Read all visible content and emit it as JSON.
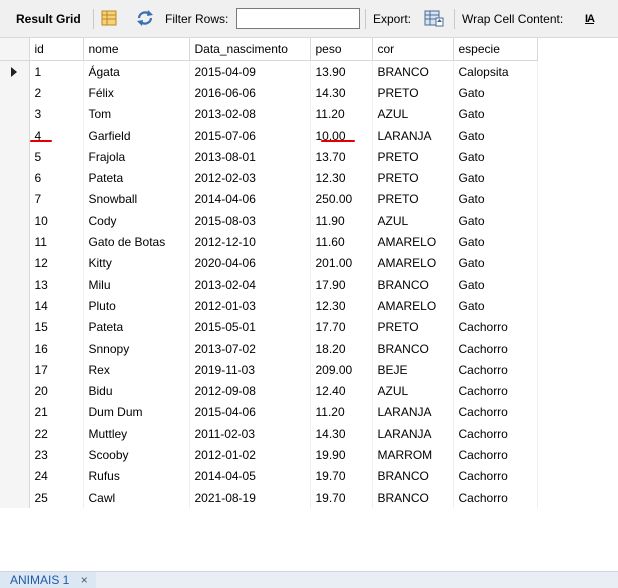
{
  "toolbar": {
    "result_grid_label": "Result Grid",
    "filter_rows_label": "Filter Rows:",
    "filter_rows_value": "",
    "export_label": "Export:",
    "wrap_cell_label": "Wrap Cell Content:",
    "wrap_icon_glyph": "IA"
  },
  "grid": {
    "columns": [
      "id",
      "nome",
      "Data_nascimento",
      "peso",
      "cor",
      "especie"
    ],
    "rows": [
      [
        "1",
        "Ágata",
        "2015-04-09",
        "13.90",
        "BRANCO",
        "Calopsita"
      ],
      [
        "2",
        "Félix",
        "2016-06-06",
        "14.30",
        "PRETO",
        "Gato"
      ],
      [
        "3",
        "Tom",
        "2013-02-08",
        "11.20",
        "AZUL",
        "Gato"
      ],
      [
        "4",
        "Garfield",
        "2015-07-06",
        "10.00",
        "LARANJA",
        "Gato"
      ],
      [
        "5",
        "Frajola",
        "2013-08-01",
        "13.70",
        "PRETO",
        "Gato"
      ],
      [
        "6",
        "Pateta",
        "2012-02-03",
        "12.30",
        "PRETO",
        "Gato"
      ],
      [
        "7",
        "Snowball",
        "2014-04-06",
        "250.00",
        "PRETO",
        "Gato"
      ],
      [
        "10",
        "Cody",
        "2015-08-03",
        "11.90",
        "AZUL",
        "Gato"
      ],
      [
        "11",
        "Gato de Botas",
        "2012-12-10",
        "11.60",
        "AMARELO",
        "Gato"
      ],
      [
        "12",
        "Kitty",
        "2020-04-06",
        "201.00",
        "AMARELO",
        "Gato"
      ],
      [
        "13",
        "Milu",
        "2013-02-04",
        "17.90",
        "BRANCO",
        "Gato"
      ],
      [
        "14",
        "Pluto",
        "2012-01-03",
        "12.30",
        "AMARELO",
        "Gato"
      ],
      [
        "15",
        "Pateta",
        "2015-05-01",
        "17.70",
        "PRETO",
        "Cachorro"
      ],
      [
        "16",
        "Snnopy",
        "2013-07-02",
        "18.20",
        "BRANCO",
        "Cachorro"
      ],
      [
        "17",
        "Rex",
        "2019-11-03",
        "209.00",
        "BEJE",
        "Cachorro"
      ],
      [
        "20",
        "Bidu",
        "2012-09-08",
        "12.40",
        "AZUL",
        "Cachorro"
      ],
      [
        "21",
        "Dum Dum",
        "2015-04-06",
        "11.20",
        "LARANJA",
        "Cachorro"
      ],
      [
        "22",
        "Muttley",
        "2011-02-03",
        "14.30",
        "LARANJA",
        "Cachorro"
      ],
      [
        "23",
        "Scooby",
        "2012-01-02",
        "19.90",
        "MARROM",
        "Cachorro"
      ],
      [
        "24",
        "Rufus",
        "2014-04-05",
        "19.70",
        "BRANCO",
        "Cachorro"
      ],
      [
        "25",
        "Cawl",
        "2021-08-19",
        "19.70",
        "BRANCO",
        "Cachorro"
      ]
    ],
    "current_row_index": 0,
    "annotation_color": "#e00000"
  },
  "tabs": [
    {
      "label": "ANIMAIS 1",
      "close_glyph": "×"
    }
  ],
  "colors": {
    "toolbar_bg": "#f0f0f0",
    "grid_border": "#d8d8d8",
    "tab_text": "#1f5aa6",
    "refresh_icon": "#3a6fb5"
  }
}
